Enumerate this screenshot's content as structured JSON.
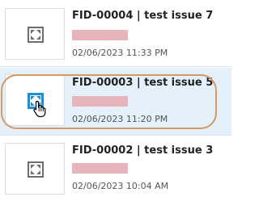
{
  "items": [
    {
      "title": "FID-00004 | test issue 7",
      "timestamp": "02/06/2023 11:33 PM",
      "icon": "expand-icon",
      "selected": false
    },
    {
      "title": "FID-00003 | test issue 5",
      "timestamp": "02/06/2023 11:20 PM",
      "icon": "expand-icon",
      "selected": true
    },
    {
      "title": "FID-00002 | test issue 3",
      "timestamp": "02/06/2023 10:04 AM",
      "icon": "expand-icon",
      "selected": false
    }
  ],
  "colors": {
    "selected_row": "#e4f0fa",
    "focus_ring": "#d49a66",
    "redaction": "#e8b4bc",
    "icon_hover": "#1a8fd8"
  }
}
